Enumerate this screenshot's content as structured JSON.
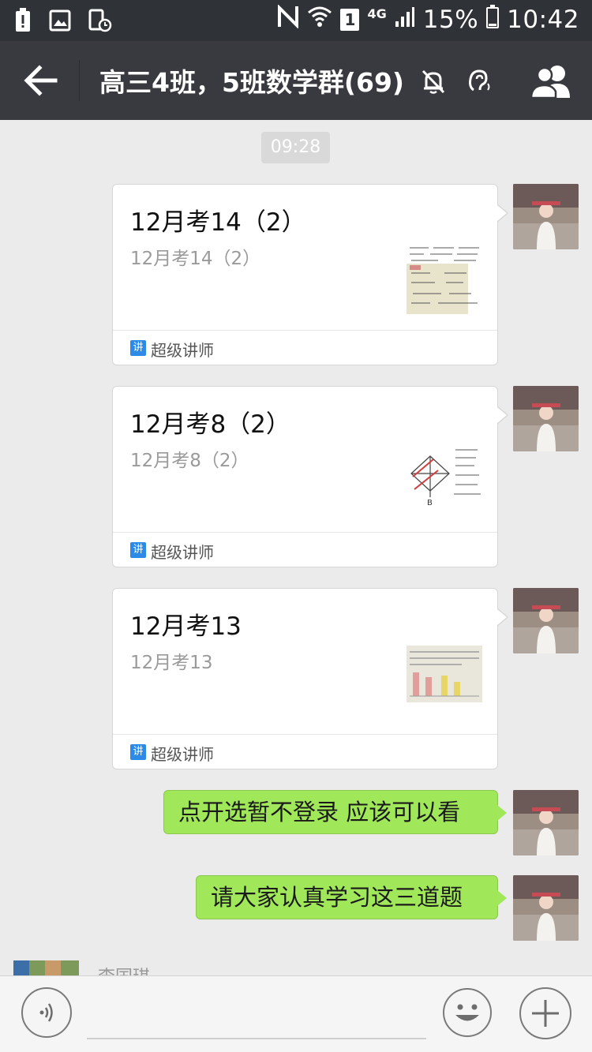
{
  "status_bar": {
    "battery_percent": "15%",
    "time": "10:42",
    "network": "4G",
    "sim": "1",
    "icons": [
      "battery-alert-icon",
      "gallery-icon",
      "screen-timer-icon",
      "nfc-icon",
      "wifi-icon",
      "sim-icon",
      "signal-icon",
      "battery-icon"
    ]
  },
  "header": {
    "title": "高三4班，5班数学群(69)",
    "icons": [
      "back-arrow-icon",
      "mute-bell-icon",
      "earpiece-icon",
      "group-members-icon"
    ]
  },
  "chat": {
    "timestamp": "09:28",
    "cards": [
      {
        "title": "12月考14（2）",
        "desc": "12月考14（2）",
        "source_icon": "讲",
        "source": "超级讲师"
      },
      {
        "title": "12月考8（2）",
        "desc": "12月考8（2）",
        "source_icon": "讲",
        "source": "超级讲师"
      },
      {
        "title": "12月考13",
        "desc": "12月考13",
        "source_icon": "讲",
        "source": "超级讲师"
      }
    ],
    "texts": [
      "点开选暂不登录 应该可以看",
      "请大家认真学习这三道题"
    ],
    "partial_sender": "李国琪"
  },
  "input_bar": {
    "icons": [
      "voice-icon",
      "emoji-icon",
      "plus-icon"
    ]
  },
  "colors": {
    "status_bar_bg": "#2f3236",
    "title_bar_bg": "#393a3f",
    "chat_bg": "#ebebeb",
    "bubble_green": "#a0e75a",
    "source_icon_blue": "#2d8be7"
  }
}
